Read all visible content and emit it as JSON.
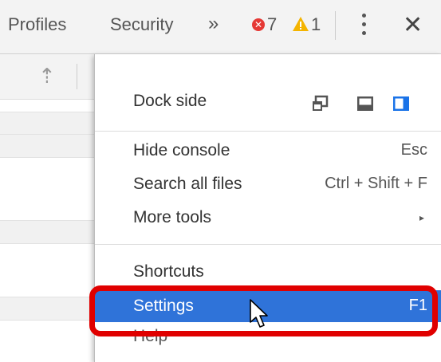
{
  "toolbar": {
    "tabs": [
      {
        "label": "Profiles"
      },
      {
        "label": "Security"
      }
    ],
    "overflow_glyph": "»",
    "errors": {
      "count": "7",
      "color": "#e53935",
      "icon": "error-circle-icon"
    },
    "warnings": {
      "count": "1",
      "color": "#f4b400",
      "icon": "warning-triangle-icon"
    },
    "menu_icon": "kebab-menu-icon",
    "close_glyph": "✕"
  },
  "left_panel": {
    "upload_glyph": "⇡"
  },
  "menu": {
    "dock_side": {
      "label": "Dock side",
      "options": [
        {
          "icon": "undock-icon"
        },
        {
          "icon": "dock-bottom-icon"
        },
        {
          "icon": "dock-right-icon",
          "active_color": "#1a73e8"
        }
      ]
    },
    "items": [
      {
        "label": "Hide console",
        "shortcut": "Esc"
      },
      {
        "label": "Search all files",
        "shortcut": "Ctrl + Shift + F"
      },
      {
        "label": "More tools",
        "submenu_glyph": "▸"
      },
      {
        "label": "Shortcuts",
        "shortcut": ""
      },
      {
        "label": "Settings",
        "shortcut": "F1",
        "highlighted": true
      },
      {
        "label": "Help",
        "shortcut": ""
      }
    ],
    "highlight_color": "#2f73d9"
  },
  "annotation": {
    "color": "#e00000"
  }
}
